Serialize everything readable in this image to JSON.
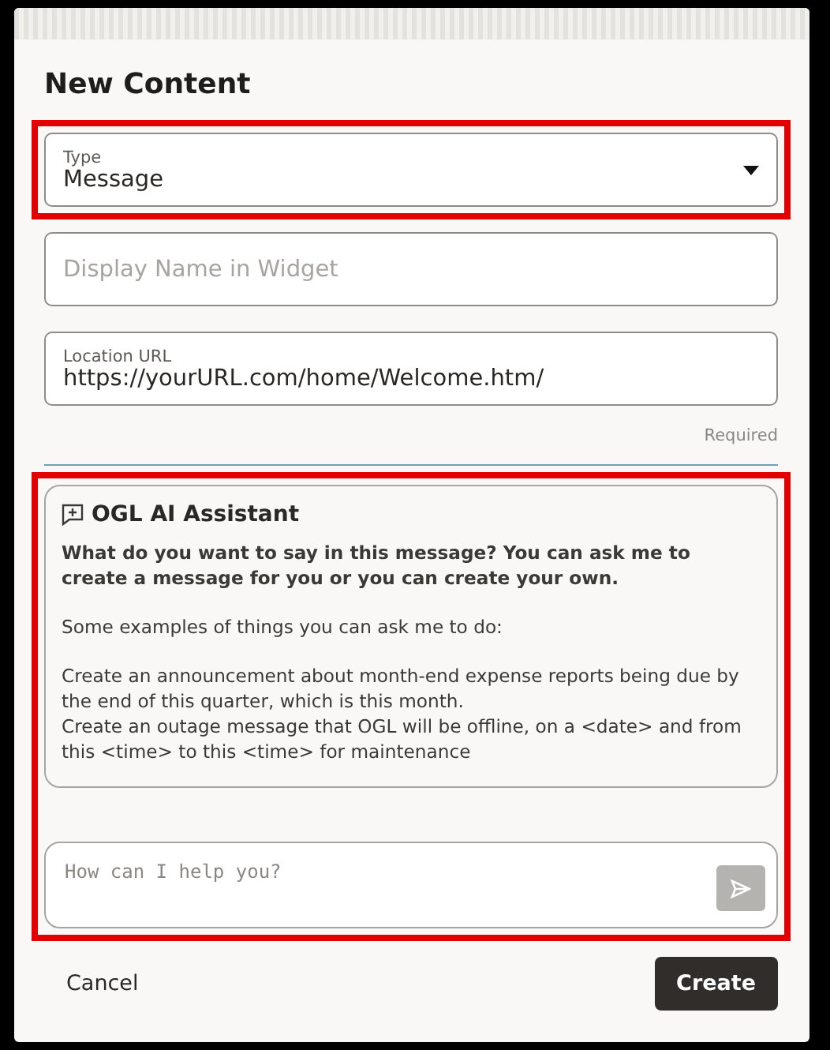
{
  "dialog": {
    "title": "New Content"
  },
  "fields": [
    {
      "kind": "select",
      "label": "Type",
      "value": "Message",
      "highlighted": true
    },
    {
      "kind": "text",
      "placeholder": "Display Name in Widget",
      "highlighted": false
    },
    {
      "kind": "text",
      "label": "Location URL",
      "value": "https://yourURL.com/home/Welcome.htm/",
      "helper": "Required",
      "highlighted": false
    }
  ],
  "assistant": {
    "highlighted": true,
    "title": "OGL AI Assistant",
    "prompt": "What do you want to say in this message? You can ask me to create a message for you or you can create your own.",
    "intro": "Some examples of things you can ask me to do:",
    "examples": [
      "Create an announcement about month-end expense reports being due by the end of this quarter, which is this month.",
      "Create an outage message that OGL will be offline, on a <date> and from this <time> to this <time> for maintenance"
    ],
    "input": {
      "placeholder": "How can I help you?"
    },
    "send_disabled": true
  },
  "buttons": [
    {
      "kind": "secondary",
      "label": "Cancel"
    },
    {
      "kind": "primary",
      "label": "Create"
    }
  ]
}
